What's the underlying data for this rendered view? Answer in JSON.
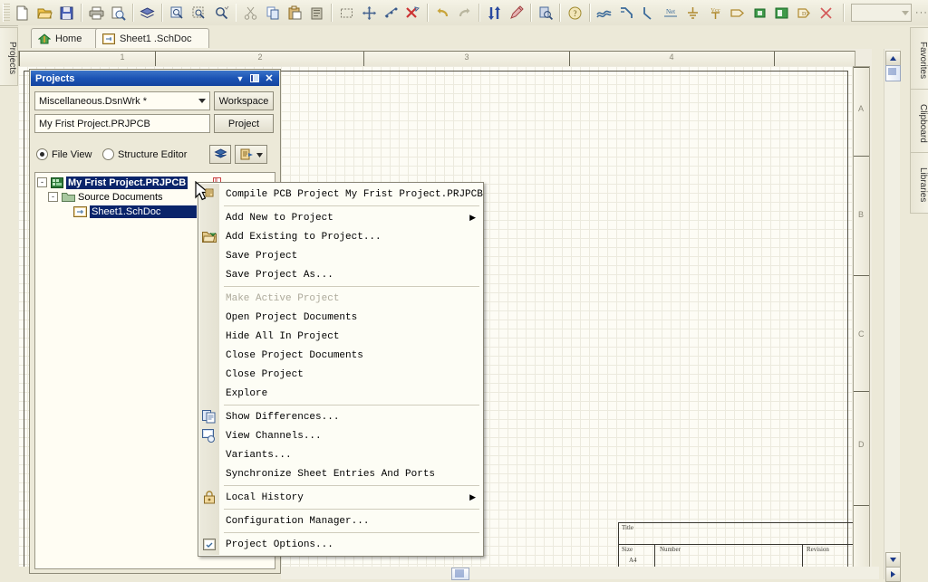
{
  "app": {
    "toolbar_combo_value": "",
    "toolbar_overflow": "···"
  },
  "toolbar": {
    "groups": [
      {
        "buttons": [
          {
            "name": "new-document-icon",
            "label": "New"
          },
          {
            "name": "open-document-icon",
            "label": "Open"
          },
          {
            "name": "save-icon",
            "label": "Save"
          }
        ]
      },
      {
        "buttons": [
          {
            "name": "print-icon",
            "label": "Print"
          },
          {
            "name": "print-preview-icon",
            "label": "Print Preview"
          }
        ]
      },
      {
        "buttons": [
          {
            "name": "layers-icon",
            "label": "Board Layers"
          }
        ]
      },
      {
        "buttons": [
          {
            "name": "zoom-document-icon",
            "label": "Fit Document"
          },
          {
            "name": "zoom-area-icon",
            "label": "Zoom Area"
          },
          {
            "name": "zoom-selected-icon",
            "label": "Zoom Selected"
          }
        ]
      },
      {
        "buttons": [
          {
            "name": "cut-icon",
            "label": "Cut"
          },
          {
            "name": "copy-icon",
            "label": "Copy"
          },
          {
            "name": "paste-icon",
            "label": "Paste"
          },
          {
            "name": "paste-special-icon",
            "label": "Paste Special"
          }
        ]
      },
      {
        "buttons": [
          {
            "name": "select-area-icon",
            "label": "Select Area"
          },
          {
            "name": "move-icon",
            "label": "Move"
          },
          {
            "name": "deselect-icon",
            "label": "Deselect"
          },
          {
            "name": "clear-selection-icon",
            "label": "Clear Selection"
          }
        ]
      },
      {
        "buttons": [
          {
            "name": "undo-icon",
            "label": "Undo"
          },
          {
            "name": "redo-icon",
            "label": "Redo"
          }
        ]
      },
      {
        "buttons": [
          {
            "name": "update-icon",
            "label": "Update"
          },
          {
            "name": "annotate-icon",
            "label": "Annotate"
          }
        ]
      },
      {
        "buttons": [
          {
            "name": "browse-library-icon",
            "label": "Browse Library"
          }
        ]
      },
      {
        "buttons": [
          {
            "name": "help-icon",
            "label": "Help"
          }
        ]
      },
      {
        "buttons": [
          {
            "name": "place-wire-icon",
            "label": "Place Wire"
          },
          {
            "name": "place-bus-icon",
            "label": "Place Bus"
          },
          {
            "name": "place-bus-entry-icon",
            "label": "Place Bus Entry"
          },
          {
            "name": "place-net-label-icon",
            "label": "Net"
          },
          {
            "name": "place-gnd-icon",
            "label": "Place GND Power Port"
          },
          {
            "name": "place-vcc-icon",
            "label": "Vcc"
          },
          {
            "name": "place-port-icon",
            "label": "Place Port"
          },
          {
            "name": "place-part-icon",
            "label": "Place Part"
          },
          {
            "name": "place-sheet-symbol-icon",
            "label": "Place Sheet Symbol"
          },
          {
            "name": "place-sheet-entry-icon",
            "label": "Place Sheet Entry"
          },
          {
            "name": "no-erc-icon",
            "label": "Place No ERC"
          }
        ]
      }
    ]
  },
  "tabs": [
    {
      "label": "Home",
      "icon": "home-icon"
    },
    {
      "label": "Sheet1 .SchDoc",
      "icon": "schematic-doc-icon"
    }
  ],
  "left_tab": {
    "label": "Projects"
  },
  "right_tabs": [
    {
      "label": "Favorites"
    },
    {
      "label": "Clipboard"
    },
    {
      "label": "Libraries"
    }
  ],
  "projects_panel": {
    "title": "Projects",
    "title_buttons": [
      {
        "name": "panel-dropdown-icon",
        "glyph": "▼"
      },
      {
        "name": "panel-pin-icon",
        "glyph": "⧉"
      },
      {
        "name": "panel-close-icon",
        "glyph": "✕"
      }
    ],
    "workspace_combo_value": "Miscellaneous.DsnWrk *",
    "workspace_button": "Workspace",
    "project_field_value": "My Frist Project.PRJPCB",
    "project_button": "Project",
    "view_modes": [
      {
        "label": "File View",
        "selected": true
      },
      {
        "label": "Structure Editor",
        "selected": false
      }
    ],
    "tool_buttons": [
      {
        "name": "compile-project-button"
      },
      {
        "name": "open-document-dropdown-button"
      }
    ],
    "tree": [
      {
        "label": "My Frist Project.PRJPCB",
        "level": 0,
        "expander": "-",
        "icon": "project-icon",
        "selected": true
      },
      {
        "label": "Source Documents",
        "level": 1,
        "expander": "-",
        "icon": "folder-icon",
        "selected": false
      },
      {
        "label": "Sheet1.SchDoc",
        "level": 2,
        "expander": "",
        "icon": "schematic-doc-icon",
        "selected": true
      }
    ]
  },
  "context_menu": {
    "items": [
      {
        "label": "Compile PCB Project My Frist Project.PRJPCB",
        "accel": "C",
        "icon": null,
        "submenu": false,
        "disabled": false
      },
      {
        "sep": true
      },
      {
        "label": "Add New to Project",
        "accel": "N",
        "icon": null,
        "submenu": true,
        "disabled": false
      },
      {
        "label": "Add Existing to Project...",
        "accel": "A",
        "icon": "add-existing-icon",
        "submenu": false,
        "disabled": false
      },
      {
        "label": "Save Project",
        "accel": null,
        "icon": null,
        "submenu": false,
        "disabled": false
      },
      {
        "label": "Save Project As...",
        "accel": null,
        "icon": null,
        "submenu": false,
        "disabled": false
      },
      {
        "sep": true
      },
      {
        "label": "Make Active Project",
        "accel": "M",
        "icon": null,
        "submenu": false,
        "disabled": true
      },
      {
        "label": "Open Project Documents",
        "accel": null,
        "icon": null,
        "submenu": false,
        "disabled": false
      },
      {
        "label": "Hide All In Project",
        "accel": null,
        "icon": null,
        "submenu": false,
        "disabled": false
      },
      {
        "label": "Close Project Documents",
        "accel": "l",
        "icon": null,
        "submenu": false,
        "disabled": false
      },
      {
        "label": "Close Project",
        "accel": null,
        "icon": null,
        "submenu": false,
        "disabled": false
      },
      {
        "label": "Explore",
        "accel": null,
        "icon": null,
        "submenu": false,
        "disabled": false
      },
      {
        "sep": true
      },
      {
        "label": "Show Differences...",
        "accel": "S",
        "icon": "show-differences-icon",
        "submenu": false,
        "disabled": false
      },
      {
        "label": "View Channels...",
        "accel": "h",
        "icon": "view-channels-icon",
        "submenu": false,
        "disabled": false
      },
      {
        "label": "Variants...",
        "accel": "V",
        "icon": null,
        "submenu": false,
        "disabled": false
      },
      {
        "label": "Synchronize Sheet Entries And Ports",
        "accel": null,
        "icon": null,
        "submenu": false,
        "disabled": false
      },
      {
        "sep": true
      },
      {
        "label": "Local History",
        "accel": "t",
        "icon": "lock-icon",
        "submenu": true,
        "disabled": false
      },
      {
        "sep": true
      },
      {
        "label": "Configuration Manager...",
        "accel": null,
        "icon": null,
        "submenu": false,
        "disabled": false
      },
      {
        "sep": true
      },
      {
        "label": "Project Options...",
        "accel": "O",
        "icon": "project-options-icon",
        "submenu": false,
        "disabled": false
      }
    ]
  },
  "editor": {
    "ruler_top_labels": [
      "1",
      "2",
      "3",
      "4"
    ],
    "ruler_right_labels": [
      "A",
      "B",
      "C",
      "D"
    ],
    "title_block": {
      "title_label": "Title",
      "size_label": "Size",
      "size_value": "A4",
      "number_label": "Number",
      "revision_label": "Revision"
    }
  },
  "colors": {
    "titlebar_blue": "#1b53b4",
    "selection_blue": "#0a246a",
    "chrome": "#ece9d8",
    "canvas": "#fdfcf5"
  }
}
